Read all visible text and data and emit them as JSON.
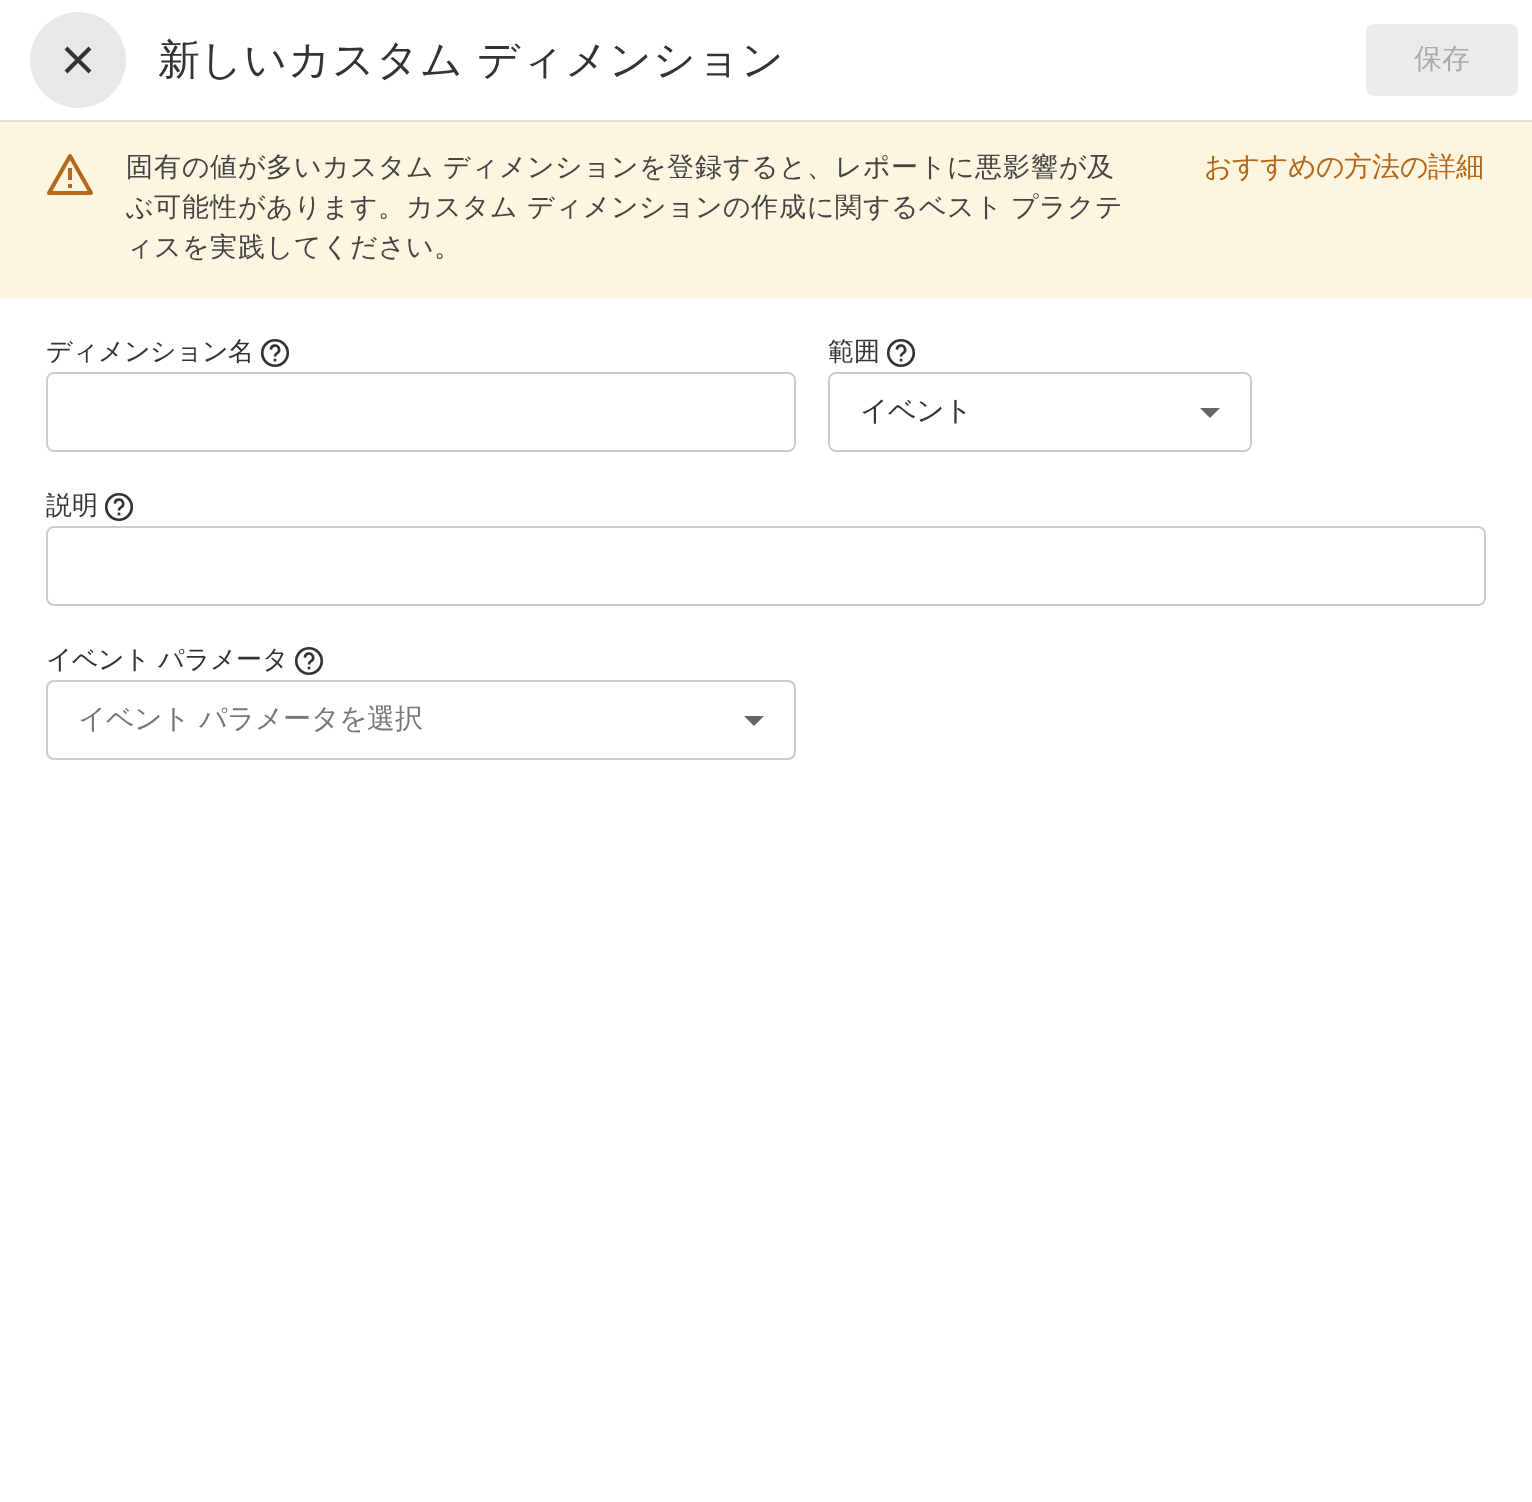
{
  "header": {
    "title": "新しいカスタム ディメンション"
  },
  "save_button": {
    "label": "保存",
    "disabled": true
  },
  "banner": {
    "message": "固有の値が多いカスタム ディメンションを登録すると、レポートに悪影響が及ぶ可能性があります。カスタム ディメンションの作成に関するベスト プラクティスを実践してください。",
    "link": "おすすめの方法の詳細"
  },
  "form_rows": [
    [
      {
        "kind": "text",
        "label": "ディメンション名"
      },
      {
        "kind": "dropdown",
        "label": "範囲",
        "value": "イベント"
      }
    ],
    [
      {
        "kind": "text",
        "label": "説明"
      }
    ],
    [
      {
        "kind": "dropdown",
        "label": "イベント パラメータ",
        "placeholder": "イベント パラメータを選択"
      }
    ]
  ]
}
